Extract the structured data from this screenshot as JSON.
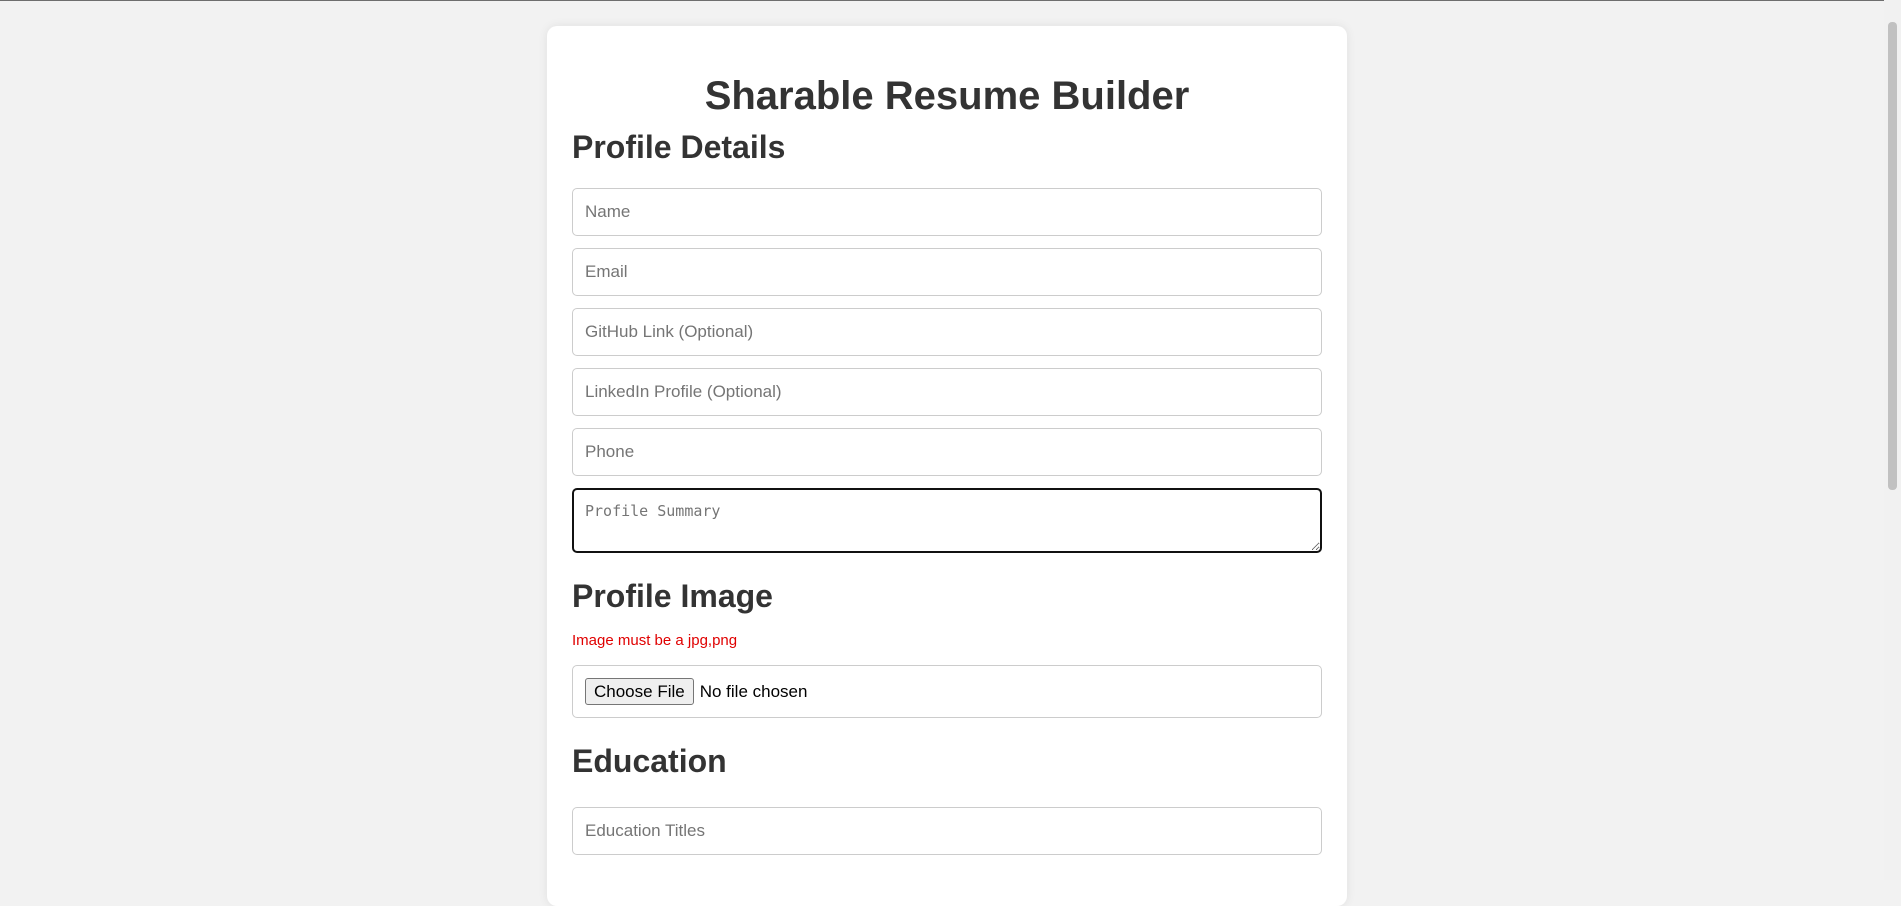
{
  "page": {
    "title": "Sharable Resume Builder"
  },
  "profile_details": {
    "heading": "Profile Details",
    "name_placeholder": "Name",
    "email_placeholder": "Email",
    "github_placeholder": "GitHub Link (Optional)",
    "linkedin_placeholder": "LinkedIn Profile (Optional)",
    "phone_placeholder": "Phone",
    "summary_placeholder": "Profile Summary"
  },
  "profile_image": {
    "heading": "Profile Image",
    "error_text": "Image must be a jpg,png",
    "choose_button_label": "Choose File",
    "file_status": "No file chosen"
  },
  "education": {
    "heading": "Education",
    "titles_placeholder": "Education Titles"
  },
  "colors": {
    "background": "#f2f2f2",
    "card": "#ffffff",
    "heading_text": "#333333",
    "error": "#e00000"
  }
}
